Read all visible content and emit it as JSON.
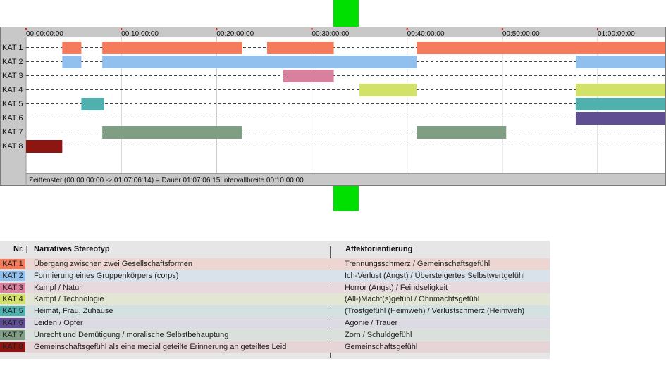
{
  "chart_data": {
    "type": "timeline",
    "x_unit": "minutes",
    "xlim": [
      0,
      67.1
    ],
    "tick_values": [
      0,
      10,
      20,
      30,
      40,
      50,
      60
    ],
    "tick_labels": [
      "00:00:00:00",
      "00:10:00:00",
      "00:20:00:00",
      "00:30:00:00",
      "00:40:00:00",
      "00:50:00:00",
      "01:00:00:00"
    ],
    "categories": [
      "KAT 1",
      "KAT 2",
      "KAT 3",
      "KAT 4",
      "KAT 5",
      "KAT 6",
      "KAT 7",
      "KAT 8"
    ],
    "colors": [
      "#f47c5c",
      "#92c0ee",
      "#d8809e",
      "#d2e268",
      "#4fb0ae",
      "#5f4e92",
      "#809e84",
      "#8e1612"
    ],
    "series": [
      {
        "name": "KAT 1",
        "intervals": [
          [
            3.8,
            5.8
          ],
          [
            8.0,
            22.7
          ],
          [
            25.3,
            32.3
          ],
          [
            41.0,
            67.1
          ]
        ]
      },
      {
        "name": "KAT 2",
        "intervals": [
          [
            3.8,
            5.8
          ],
          [
            8.0,
            41.0
          ],
          [
            57.7,
            67.1
          ]
        ]
      },
      {
        "name": "KAT 3",
        "intervals": [
          [
            27.0,
            32.3
          ]
        ]
      },
      {
        "name": "KAT 4",
        "intervals": [
          [
            35.0,
            41.0
          ],
          [
            57.7,
            67.1
          ]
        ]
      },
      {
        "name": "KAT 5",
        "intervals": [
          [
            5.8,
            8.2
          ],
          [
            57.7,
            67.1
          ]
        ]
      },
      {
        "name": "KAT 6",
        "intervals": [
          [
            57.7,
            67.1
          ]
        ]
      },
      {
        "name": "KAT 7",
        "intervals": [
          [
            8.0,
            22.7
          ],
          [
            41.0,
            50.4
          ]
        ]
      },
      {
        "name": "KAT 8",
        "intervals": [
          [
            0,
            3.8
          ]
        ]
      }
    ],
    "footer_text": "Zeitfenster (00:00:00:00 -> 01:07:06:14) = Dauer 01:07:06:15     Intervallbreite 00:10:00:00"
  },
  "legend": {
    "header_nr": "Nr. |",
    "header_stereotype": "Narratives Stereotyp",
    "header_affect": "Affektorientierung",
    "rows": [
      {
        "kat": "KAT 1",
        "stereotype": "Übergang zwischen zwei Gesellschaftsformen",
        "affect": "Trennungsschmerz / Gemeinschaftsgefühl",
        "color": "#f47c5c",
        "tint": "#edd6d1"
      },
      {
        "kat": "KAT 2",
        "stereotype": "Formierung eines Gruppenkörpers (corps)",
        "affect": "Ich-Verlust (Angst) / Übersteigertes Selbstwertgefühl",
        "color": "#92c0ee",
        "tint": "#d9e1ea"
      },
      {
        "kat": "KAT 3",
        "stereotype": "Kampf / Natur",
        "affect": "Horror (Angst) / Feindseligkeit",
        "color": "#d8809e",
        "tint": "#e8d9de"
      },
      {
        "kat": "KAT 4",
        "stereotype": "Kampf / Technologie",
        "affect": "(All-)Macht(s)gefühl / Ohnmachtsgefühl",
        "color": "#d2e268",
        "tint": "#e3e6d2"
      },
      {
        "kat": "KAT 5",
        "stereotype": "Heimat, Frau, Zuhause",
        "affect": "(Trostgefühl (Heimweh) / Verlustschmerz (Heimweh)",
        "color": "#4fb0ae",
        "tint": "#d3e2e1"
      },
      {
        "kat": "KAT 6",
        "stereotype": "Leiden / Opfer",
        "affect": "Agonie / Trauer",
        "color": "#5f4e92",
        "tint": "#dcdae2"
      },
      {
        "kat": "KAT 7",
        "stereotype": "Unrecht und Demütigung / moralische Selbstbehauptung",
        "affect": "Zorn / Schuldgefühl",
        "color": "#809e84",
        "tint": "#dae0db"
      },
      {
        "kat": "KAT 8",
        "stereotype": "Gemeinschaftsgefühl als eine medial geteilte Erinnerung an geteiltes Leid",
        "affect": "Gemeinschaftsgefühl",
        "color": "#8e1612",
        "tint": "#e6d5d6"
      }
    ]
  }
}
